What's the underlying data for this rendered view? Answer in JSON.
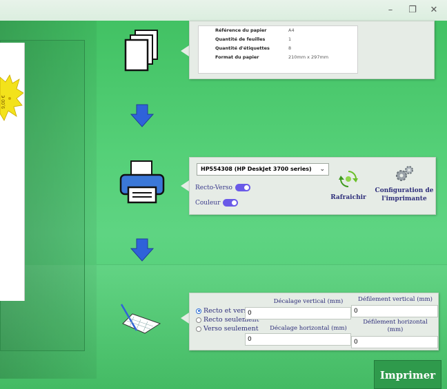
{
  "window": {
    "minimize_glyph": "–",
    "maximize_glyph": "❐",
    "close_glyph": "✕"
  },
  "preview": {
    "sticker_text": "9,00 €"
  },
  "paper_info": {
    "rows": [
      {
        "label": "Référence du papier",
        "value": "A4"
      },
      {
        "label": "Quantité de feuilles",
        "value": "1"
      },
      {
        "label": "Quantité d'étiquettes",
        "value": "8"
      },
      {
        "label": "Format du papier",
        "value": "210mm x 297mm"
      }
    ]
  },
  "printer": {
    "selected_printer": "HP554308 (HP DeskJet 3700 series)",
    "duplex_label": "Recto-Verso",
    "duplex_on": true,
    "color_label": "Couleur",
    "color_on": true,
    "refresh_label": "Rafraichir",
    "config_label_line1": "Configuration de",
    "config_label_line2": "l'imprimante"
  },
  "layout_options": {
    "radios": [
      {
        "label": "Recto et verso",
        "checked": true
      },
      {
        "label": "Recto seulement",
        "checked": false
      },
      {
        "label": "Verso seulement",
        "checked": false
      }
    ],
    "vertical_offset_label": "Décalage vertical (mm)",
    "vertical_offset_value": "0",
    "horizontal_offset_label": "Décalage horizontal (mm)",
    "horizontal_offset_value": "0",
    "vertical_scroll_label": "Défilement vertical (mm)",
    "vertical_scroll_value": "0",
    "horizontal_scroll_label_line1": "Défilement horizontal",
    "horizontal_scroll_label_line2": "(mm)",
    "horizontal_scroll_value": "0"
  },
  "actions": {
    "print_label": "Imprimer"
  },
  "colors": {
    "background": "#49c86a",
    "arrow_blue": "#2f62d9",
    "print_button": "#2f9a4c",
    "toggle_on": "#6a5ae8"
  }
}
